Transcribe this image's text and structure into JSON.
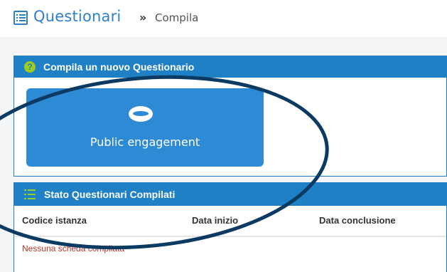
{
  "header": {
    "title": "Questionari",
    "separator": "»",
    "subtitle": "Compila",
    "icon": "list-box-icon",
    "accent_color": "#2e7fc9"
  },
  "new_panel": {
    "title": "Compila un nuovo Questionario",
    "icon": "help-circle-icon",
    "header_color": "#1f80c6",
    "tiles": [
      {
        "label": "Public engagement",
        "icon": "ring-icon",
        "color": "#2f8ad6"
      }
    ]
  },
  "status_panel": {
    "title": "Stato Questionari Compilati",
    "icon": "list-icon",
    "columns": [
      "Codice istanza",
      "Data inizio",
      "Data conclusione"
    ],
    "rows": [],
    "empty_message": "Nessuna scheda compilata"
  },
  "annotation": {
    "shape": "ellipse-highlight",
    "color": "#0b3a63"
  }
}
